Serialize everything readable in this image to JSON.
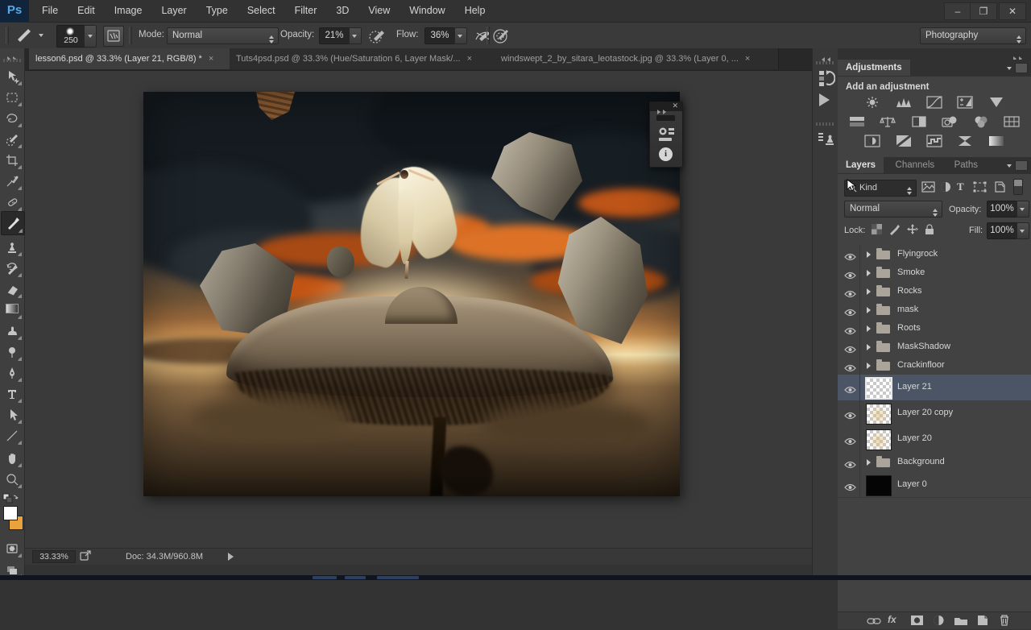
{
  "window": {
    "logo": "Ps",
    "controls": {
      "minimize": "–",
      "restore": "❐",
      "close": "✕"
    }
  },
  "menubar": {
    "items": [
      "File",
      "Edit",
      "Image",
      "Layer",
      "Type",
      "Select",
      "Filter",
      "3D",
      "View",
      "Window",
      "Help"
    ]
  },
  "options_bar": {
    "brush_size": "250",
    "mode_label": "Mode:",
    "mode_value": "Normal",
    "opacity_label": "Opacity:",
    "opacity_value": "21%",
    "flow_label": "Flow:",
    "flow_value": "36%",
    "workspace": "Photography"
  },
  "tabs": {
    "items": [
      {
        "title": "lesson6.psd @ 33.3% (Layer 21, RGB/8) *",
        "close": "×"
      },
      {
        "title": "Tuts4psd.psd @ 33.3% (Hue/Saturation 6, Layer Mask/...",
        "close": "×"
      },
      {
        "title": "windswept_2_by_sitara_leotastock.jpg @ 33.3% (Layer 0, ...",
        "close": "×"
      }
    ]
  },
  "panels": {
    "adjustments": {
      "title": "Adjustments",
      "subtitle": "Add an adjustment"
    },
    "layers": {
      "tabs": [
        "Layers",
        "Channels",
        "Paths"
      ],
      "filter_value": "Kind",
      "blend_mode": "Normal",
      "opacity_label": "Opacity:",
      "opacity_value": "100%",
      "lock_label": "Lock:",
      "fill_label": "Fill:",
      "fill_value": "100%",
      "fx_label": "fx",
      "items": [
        {
          "name": "Flyingrock",
          "kind": "group"
        },
        {
          "name": "Smoke",
          "kind": "group"
        },
        {
          "name": "Rocks",
          "kind": "group"
        },
        {
          "name": "mask",
          "kind": "group"
        },
        {
          "name": "Roots",
          "kind": "group"
        },
        {
          "name": "MaskShadow",
          "kind": "group"
        },
        {
          "name": "Crackinfloor",
          "kind": "group"
        },
        {
          "name": "Layer 21",
          "kind": "layer",
          "selected": true
        },
        {
          "name": "Layer 20 copy",
          "kind": "layer"
        },
        {
          "name": "Layer 20",
          "kind": "layer"
        },
        {
          "name": "Background",
          "kind": "group"
        },
        {
          "name": "Layer 0",
          "kind": "layer"
        }
      ]
    }
  },
  "status_bar": {
    "zoom": "33.33%",
    "doc": "Doc: 34.3M/960.8M"
  },
  "colors": {
    "selected_layer_highlight": "#4b5565",
    "foreground_swatch": "#ffffff",
    "background_swatch": "#e8a33d",
    "logo_blue": "#56a9e8"
  }
}
